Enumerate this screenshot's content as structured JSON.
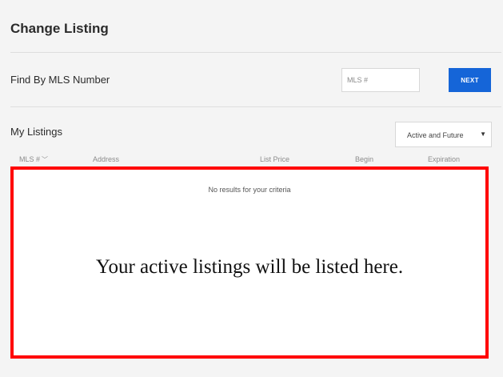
{
  "page": {
    "title": "Change Listing"
  },
  "find_by_mls": {
    "label": "Find By MLS Number",
    "input_placeholder": "MLS #",
    "input_value": "",
    "next_label": "NEXT"
  },
  "my_listings": {
    "label": "My Listings",
    "filter_selected": "Active and Future",
    "columns": [
      "MLS #",
      "Address",
      "List Price",
      "Begin",
      "Expiration"
    ],
    "sort_icon": "chevron-down-icon",
    "empty_message": "No results for your criteria",
    "annotation": "Your active listings will be listed here."
  },
  "colors": {
    "accent": "#1565d8",
    "highlight_border": "#ff0000",
    "background": "#f4f4f4"
  }
}
